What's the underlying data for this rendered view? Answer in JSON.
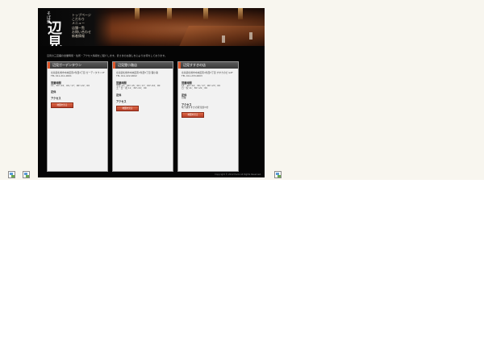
{
  "site": {
    "logo": {
      "main_text": "辺見",
      "small_text": "そば処"
    },
    "nav": [
      "トップページ",
      "こだわり",
      "メニュー",
      "店舗一覧",
      "お問い合わせ",
      "新着情報"
    ],
    "intro": "辺見の三店舗の営業時間・住所・アクセス情報をご紹介します。皆さまのお越しを心よりお待ちしております。",
    "stores": [
      {
        "name": "辺見ガーデンタウン",
        "address": "北海道札幌市中央区南2条西4丁目 ガーデンタウン1F",
        "tel": "TEL 011-211-0001",
        "hours_label": "営業時間",
        "hours": "11：30～15：00 / 17：00～22：00",
        "closed_label": "定休",
        "closed": "",
        "access_label": "アクセス",
        "note": "",
        "button_label": "地図を見る"
      },
      {
        "name": "辺見狸小路店",
        "address": "北海道札幌市中央区南3条西5丁目 狸小路",
        "tel": "TEL 011-222-0002",
        "hours_label": "営業時間",
        "hours": "平日 11：30～15：00 / 17：00～22：00",
        "hours2": "土・日・祝 11：30～21：00",
        "closed_label": "定休",
        "closed": "",
        "access_label": "アクセス",
        "note": "",
        "button_label": "地図を見る"
      },
      {
        "name": "辺見すすきの店",
        "address": "北海道札幌市中央区南4条西3丁目 すすきのビル2F",
        "tel": "TEL 011-233-0003",
        "hours_label": "営業時間",
        "hours": "11：30～14：30 / 17：00～23：00",
        "hours2": "日・祝 11：30～21：00",
        "closed_label": "定休",
        "closed": "月曜",
        "access_label": "アクセス",
        "note": "地下鉄すすきの駅 徒歩3分",
        "button_label": "地図を見る"
      }
    ],
    "copyright": "Copyright © 2012 Hemi All Rights Reserved."
  }
}
